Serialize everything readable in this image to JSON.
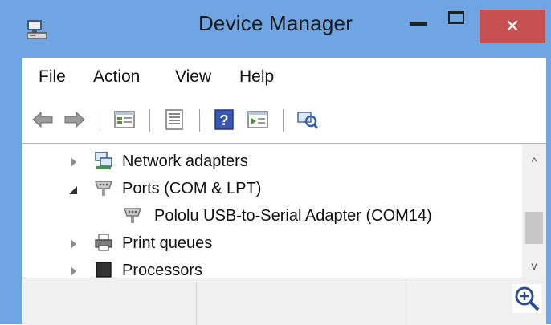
{
  "window": {
    "title": "Device Manager",
    "close_glyph": "✕"
  },
  "menu": [
    "File",
    "Action",
    "View",
    "Help"
  ],
  "toolbar": {
    "buttons": [
      "back-arrow-icon",
      "forward-arrow-icon",
      "properties-icon",
      "device-list-icon",
      "help-icon",
      "update-driver-icon",
      "scan-hardware-icon"
    ]
  },
  "tree": {
    "items": [
      {
        "label": "Network adapters",
        "state": "collapsed",
        "level": 1,
        "icon": "network-adapter-icon"
      },
      {
        "label": "Ports (COM & LPT)",
        "state": "expanded",
        "level": 1,
        "icon": "port-icon"
      },
      {
        "label": "Pololu USB-to-Serial Adapter (COM14)",
        "state": "leaf",
        "level": 2,
        "icon": "port-device-icon"
      },
      {
        "label": "Print queues",
        "state": "collapsed",
        "level": 1,
        "icon": "printer-icon"
      },
      {
        "label": "Processors",
        "state": "collapsed",
        "level": 1,
        "icon": "processor-icon"
      }
    ]
  },
  "scrollbar": {
    "up_glyph": "^",
    "down_glyph": "v"
  },
  "colors": {
    "frame": "#6fa5e3",
    "close_button": "#c75050"
  }
}
